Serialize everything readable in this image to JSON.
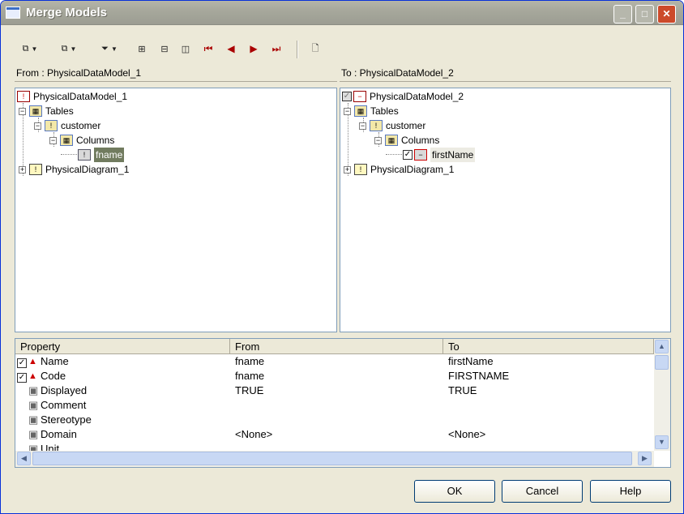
{
  "window": {
    "title": "Merge Models"
  },
  "title_buttons": {
    "minimize": "_",
    "maximize": "□",
    "close": "✕"
  },
  "from_pane": {
    "header": "From : PhysicalDataModel_1",
    "root": "PhysicalDataModel_1",
    "tables": "Tables",
    "table": "customer",
    "columns": "Columns",
    "column": "fname",
    "diagram": "PhysicalDiagram_1"
  },
  "to_pane": {
    "header": "To : PhysicalDataModel_2",
    "root": "PhysicalDataModel_2",
    "tables": "Tables",
    "table": "customer",
    "columns": "Columns",
    "column": "firstName",
    "diagram": "PhysicalDiagram_1"
  },
  "grid": {
    "headers": [
      "Property",
      "From",
      "To"
    ],
    "rows": [
      {
        "property": "Name",
        "from": "fname",
        "to": "firstName",
        "checked": true
      },
      {
        "property": "Code",
        "from": "fname",
        "to": "FIRSTNAME",
        "checked": true
      },
      {
        "property": "Displayed",
        "from": "TRUE",
        "to": "TRUE",
        "checked": false
      },
      {
        "property": "Comment",
        "from": "",
        "to": "",
        "checked": false
      },
      {
        "property": "Stereotype",
        "from": "",
        "to": "",
        "checked": false
      },
      {
        "property": "Domain",
        "from": "<None>",
        "to": "<None>",
        "checked": false
      },
      {
        "property": "Unit",
        "from": "",
        "to": "",
        "checked": false
      }
    ]
  },
  "buttons": {
    "ok": "OK",
    "cancel": "Cancel",
    "help": "Help"
  }
}
